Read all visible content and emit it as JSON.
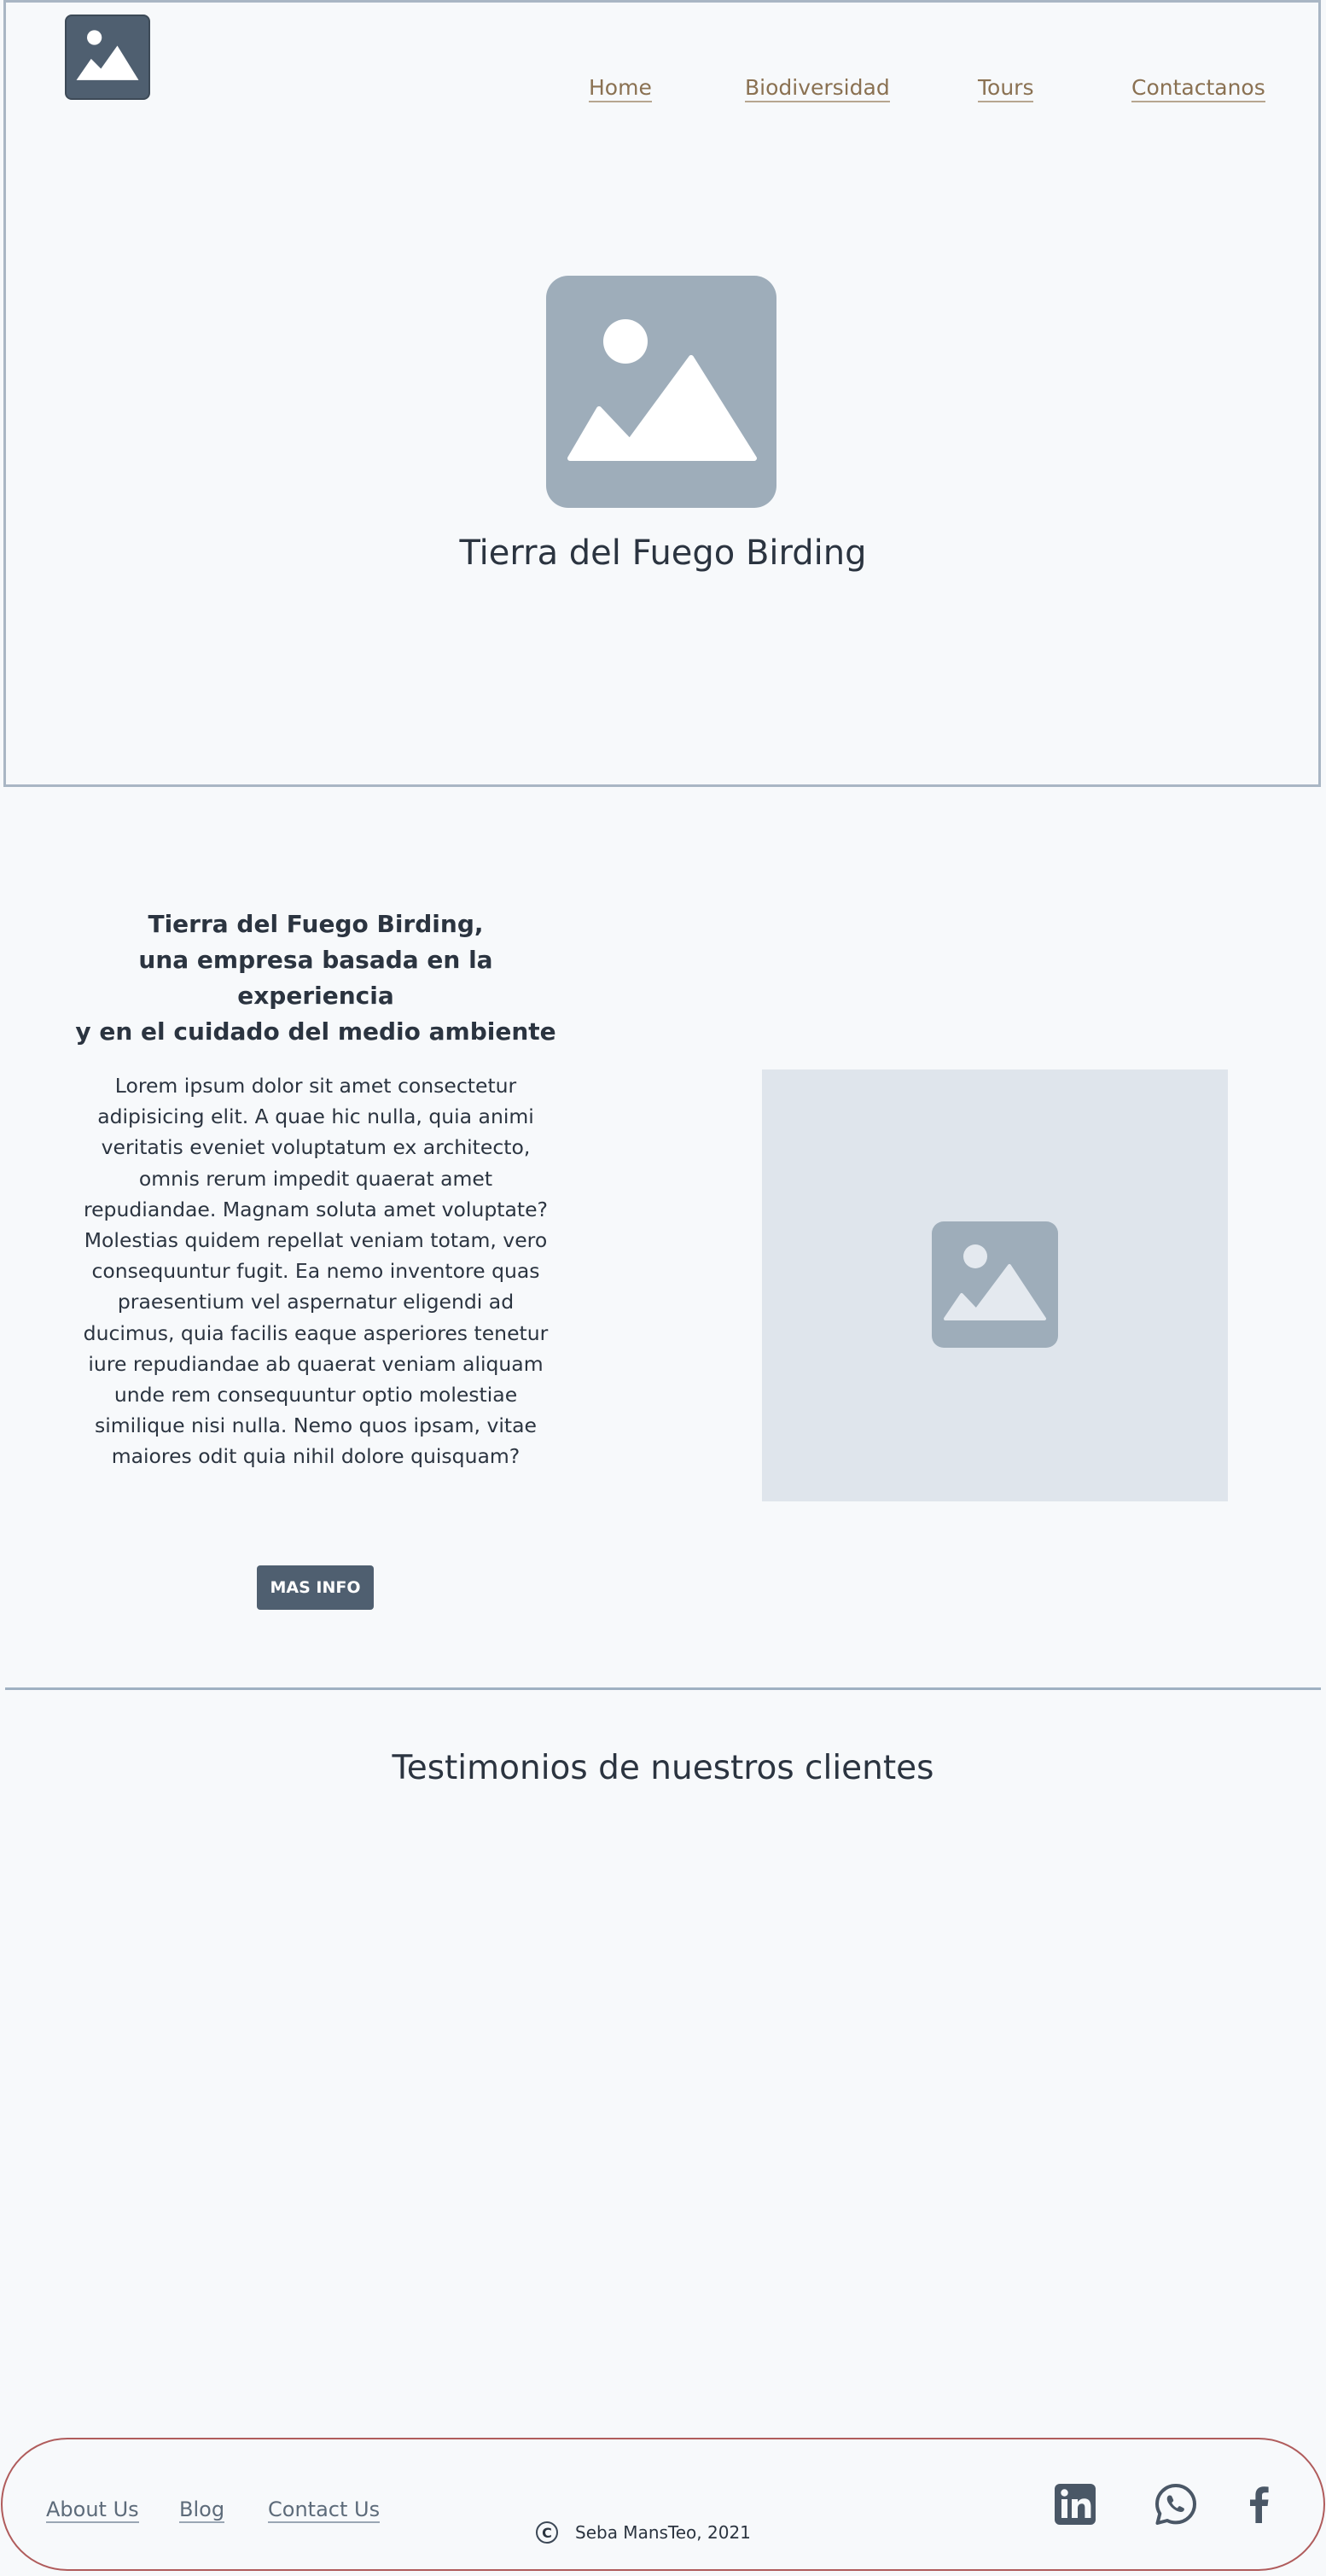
{
  "header": {
    "logo_icon": "image-placeholder-icon",
    "nav": [
      {
        "label": "Home"
      },
      {
        "label": "Biodiversidad"
      },
      {
        "label": "Tours"
      },
      {
        "label": "Contactanos"
      }
    ],
    "hero_icon": "image-placeholder-icon",
    "hero_title": "Tierra del Fuego Birding"
  },
  "about": {
    "heading_lines": [
      "Tierra del Fuego Birding,",
      "una empresa basada en la experiencia",
      "y en el cuidado del medio ambiente"
    ],
    "body": "Lorem ipsum dolor sit amet consectetur adipisicing elit. A quae hic nulla, quia animi veritatis eveniet voluptatum ex architecto, omnis rerum impedit quaerat amet repudiandae. Magnam soluta amet voluptate? Molestias quidem repellat veniam totam, vero consequuntur fugit. Ea nemo inventore quas praesentium vel aspernatur eligendi ad ducimus, quia facilis eaque asperiores tenetur iure repudiandae ab quaerat veniam aliquam unde rem consequuntur optio molestiae similique nisi nulla. Nemo quos ipsam, vitae maiores odit quia nihil dolore quisquam?",
    "button_label": "MAS INFO",
    "image_icon": "image-placeholder-icon"
  },
  "testimonials": {
    "title": "Testimonios de nuestros clientes"
  },
  "footer": {
    "links": [
      {
        "label": "About Us"
      },
      {
        "label": "Blog"
      },
      {
        "label": "Contact Us"
      }
    ],
    "copyright_icon": "copyright-icon",
    "copyright_text": "Seba MansTeo, 2021",
    "social": [
      "linkedin-icon",
      "whatsapp-icon",
      "facebook-icon"
    ]
  },
  "colors": {
    "background": "#f7f9fb",
    "nav_link": "#8a7152",
    "button": "#4f5f70",
    "placeholder": "#9eadba",
    "footer_border": "#b05c5c"
  }
}
